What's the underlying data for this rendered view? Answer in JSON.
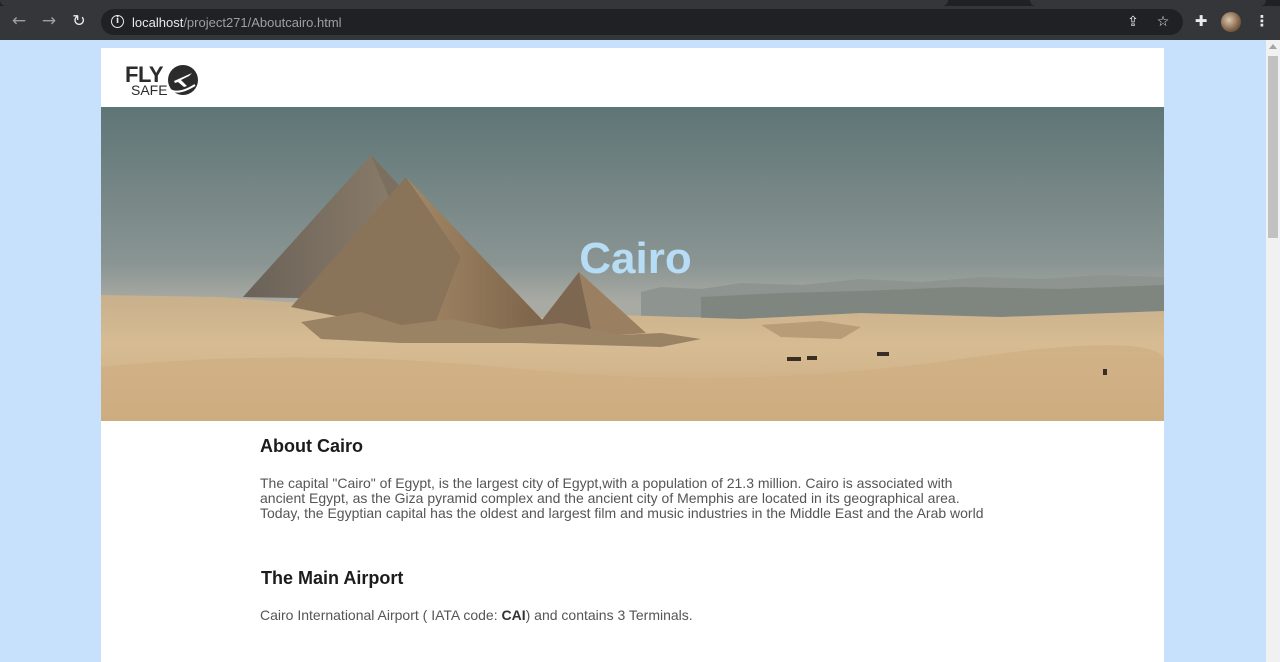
{
  "browser": {
    "url_host": "localhost",
    "url_path": "/project271/Aboutcairo.html"
  },
  "site": {
    "logo_top": "FLY",
    "logo_bottom": "SAFE"
  },
  "hero": {
    "title": "Cairo"
  },
  "about": {
    "heading": "About Cairo",
    "text": "The capital \"Cairo\" of Egypt, is the largest city of Egypt,with a population of 21.3 million. Cairo is associated with ancient Egypt, as the Giza pyramid complex and the ancient city of Memphis are located in its geographical area. Today, the Egyptian capital has the oldest and largest film and music industries in the Middle East and the Arab world"
  },
  "airport": {
    "heading": "The Main Airport",
    "text_before": "Cairo International Airport ( IATA code: ",
    "code": "CAI",
    "text_after": ") and contains 3 Terminals."
  }
}
